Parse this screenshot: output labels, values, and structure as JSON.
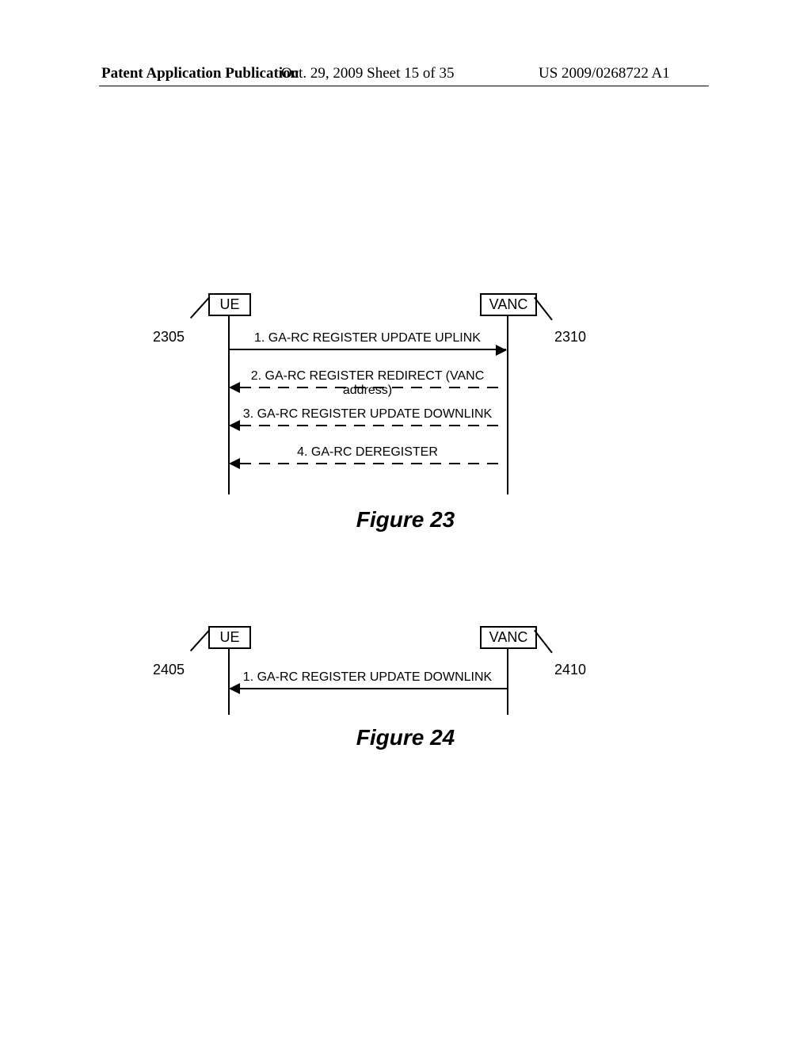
{
  "header": {
    "left": "Patent Application Publication",
    "center": "Oct. 29, 2009  Sheet 15 of 35",
    "right": "US 2009/0268722 A1"
  },
  "figure23": {
    "caption": "Figure 23",
    "ue": {
      "label": "UE",
      "ref": "2305"
    },
    "vanc": {
      "label": "VANC",
      "ref": "2310"
    },
    "messages": [
      {
        "text": "1. GA-RC REGISTER UPDATE UPLINK",
        "dir": "right",
        "style": "solid"
      },
      {
        "text": "2. GA-RC REGISTER REDIRECT (VANC address)",
        "dir": "left",
        "style": "dashed"
      },
      {
        "text": "3. GA-RC REGISTER UPDATE DOWNLINK",
        "dir": "left",
        "style": "dashed"
      },
      {
        "text": "4. GA-RC DEREGISTER",
        "dir": "left",
        "style": "dashed"
      }
    ]
  },
  "figure24": {
    "caption": "Figure 24",
    "ue": {
      "label": "UE",
      "ref": "2405"
    },
    "vanc": {
      "label": "VANC",
      "ref": "2410"
    },
    "messages": [
      {
        "text": "1. GA-RC REGISTER UPDATE DOWNLINK",
        "dir": "left",
        "style": "solid"
      }
    ]
  }
}
